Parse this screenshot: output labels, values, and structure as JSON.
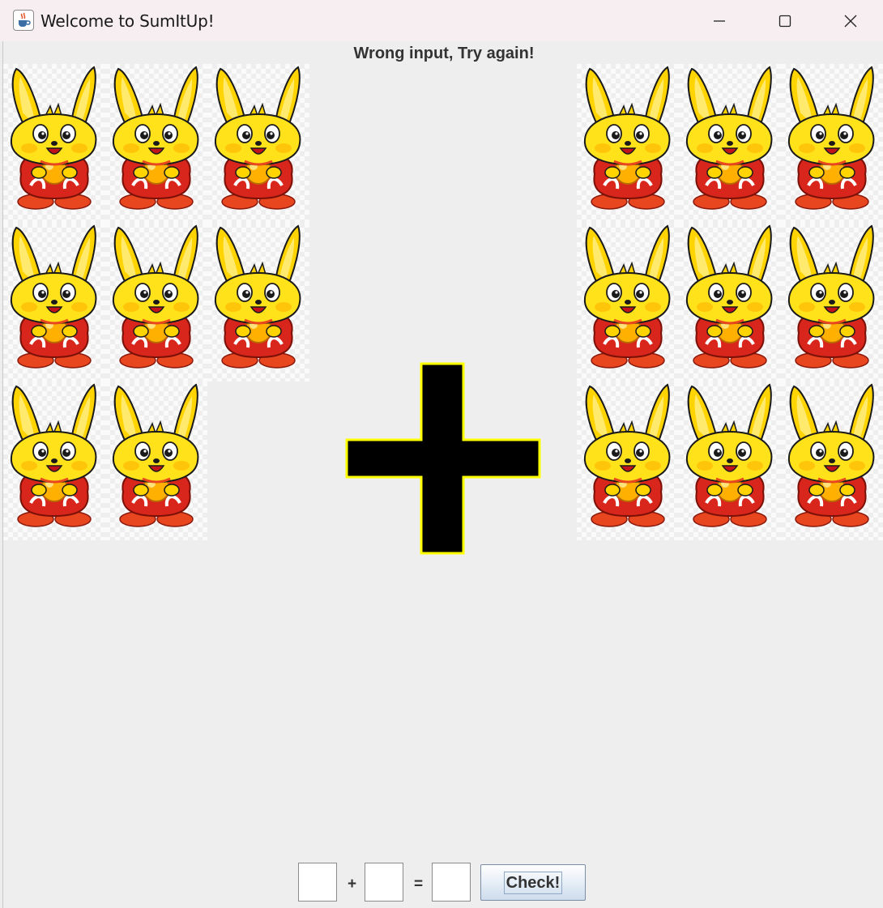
{
  "window": {
    "title": "Welcome to SumItUp!",
    "icon": "java-coffee-icon",
    "controls": [
      "minimize-icon",
      "maximize-icon",
      "close-icon"
    ]
  },
  "status_message": "Wrong input, Try again!",
  "left_group": {
    "count": 8,
    "image": "bunny"
  },
  "operator_image": {
    "symbol": "plus",
    "fill": "#000000",
    "outline": "#ffff00"
  },
  "right_group": {
    "count": 9,
    "image": "bunny"
  },
  "equation": {
    "first_value": "",
    "plus_label": "+",
    "second_value": "",
    "equals_label": "=",
    "answer_value": "",
    "check_label": "Check!"
  },
  "colors": {
    "window_bg": "#eeeeee",
    "titlebar_bg": "#f7eef2",
    "status_text": "#333333",
    "bunny_yellow": "#ffe21a",
    "bunny_red": "#d9261c"
  }
}
